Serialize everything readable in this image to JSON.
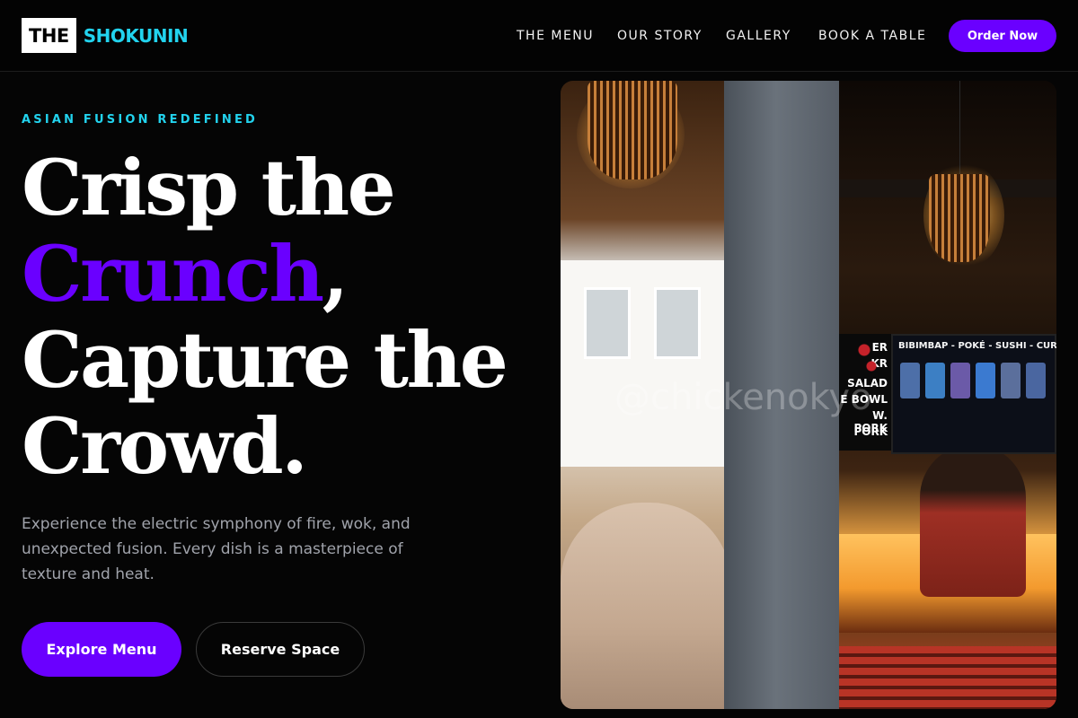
{
  "brand": {
    "logo_prefix": "THE",
    "logo_name": "SHOKUNIN",
    "accent_color": "#6a00ff",
    "cyan_color": "#22d3ee"
  },
  "nav": {
    "items": [
      {
        "label": "THE MENU"
      },
      {
        "label": "OUR STORY"
      },
      {
        "label": "GALLERY"
      },
      {
        "label": "BOOK A TABLE"
      }
    ],
    "cta_label": "Order Now"
  },
  "hero": {
    "eyebrow": "ASIAN FUSION REDEFINED",
    "headline": {
      "line1": "Crisp the",
      "line2_accent": "Crunch",
      "line2_rest": ",",
      "line3": "Capture the",
      "line4": "Crowd."
    },
    "description": "Experience the electric symphony of fire, wok, and unexpected fusion. Every dish is a masterpiece of texture and heat.",
    "primary_button": "Explore Menu",
    "secondary_button": "Reserve Space"
  },
  "image": {
    "menu_board_title": "BIBIMBAP - POKÉ - SUSHI - CURRY -",
    "sign_lines": [
      "ER",
      "KR",
      "SALAD",
      "E BOWL",
      "W. PORK",
      "PORK"
    ],
    "watermark": "@chickenokyo"
  }
}
